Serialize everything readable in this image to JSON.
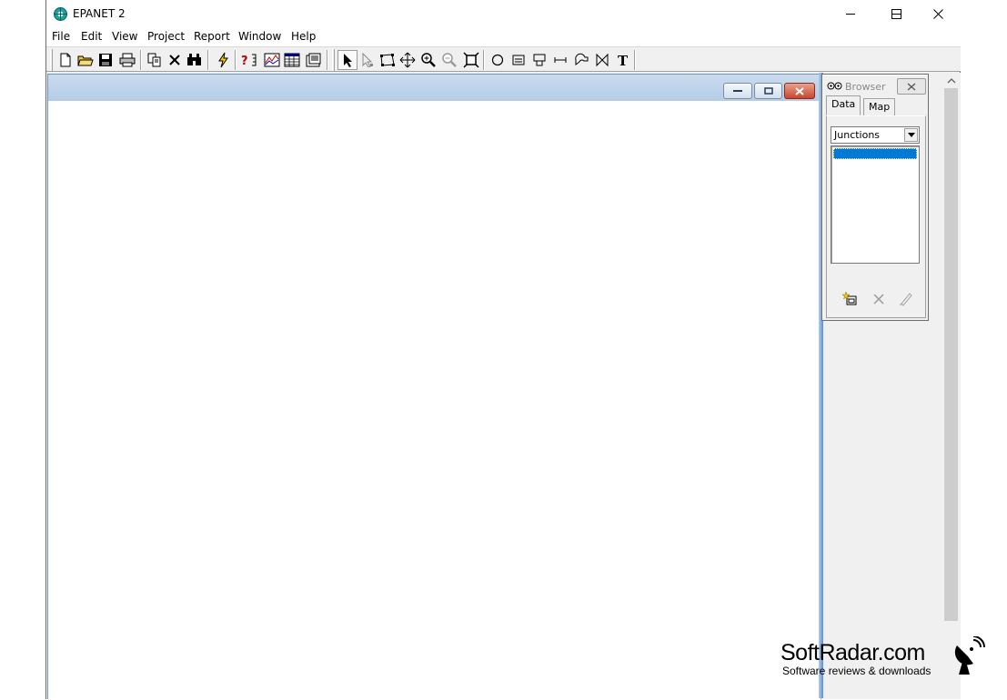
{
  "window": {
    "title": "EPANET 2",
    "caption_buttons": [
      "minimize",
      "maximize",
      "close"
    ]
  },
  "menu": {
    "items": [
      "File",
      "Edit",
      "View",
      "Project",
      "Report",
      "Window",
      "Help"
    ]
  },
  "toolbar": {
    "buttons": [
      "new-icon",
      "open-icon",
      "save-icon",
      "print-icon",
      "copy-icon",
      "delete-icon",
      "find-icon",
      "run-icon",
      "query-icon",
      "graph-icon",
      "table-icon",
      "options-icon",
      "select-object-icon",
      "select-vertex-icon",
      "select-region-icon",
      "pan-icon",
      "zoom-in-icon",
      "zoom-out-icon",
      "full-extent-icon",
      "add-junction-icon",
      "add-reservoir-icon",
      "add-tank-icon",
      "add-pipe-icon",
      "add-pump-icon",
      "add-valve-icon",
      "add-label-icon"
    ]
  },
  "browser": {
    "title": "Browser",
    "tabs": [
      "Data",
      "Map"
    ],
    "active_tab": "Data",
    "object_type": "Junctions",
    "buttons": [
      "add-icon",
      "delete-icon",
      "edit-icon"
    ]
  },
  "watermark": {
    "title": "SoftRadar.com",
    "subtitle": "Software reviews & downloads"
  },
  "colors": {
    "selection": "#0078d7",
    "mdi_caption": "#c9dbee"
  }
}
